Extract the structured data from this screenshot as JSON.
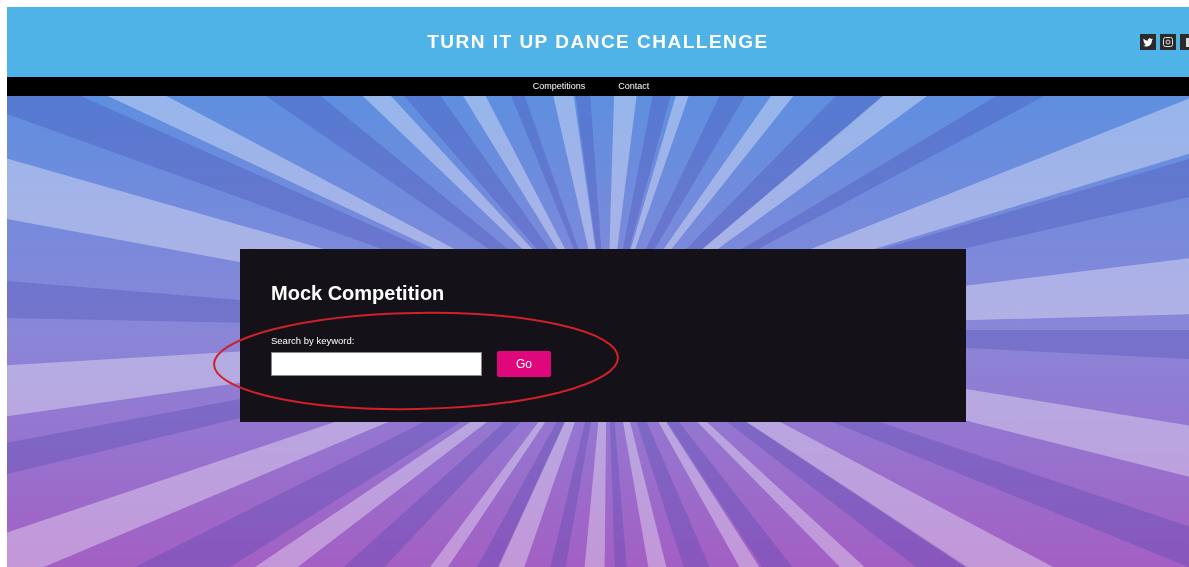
{
  "header": {
    "title": "TURN IT UP DANCE CHALLENGE"
  },
  "nav": {
    "items": [
      {
        "label": "Competitions"
      },
      {
        "label": "Contact"
      }
    ]
  },
  "panel": {
    "title": "Mock Competition",
    "search": {
      "label": "Search by keyword:"
    },
    "button": "Go"
  }
}
